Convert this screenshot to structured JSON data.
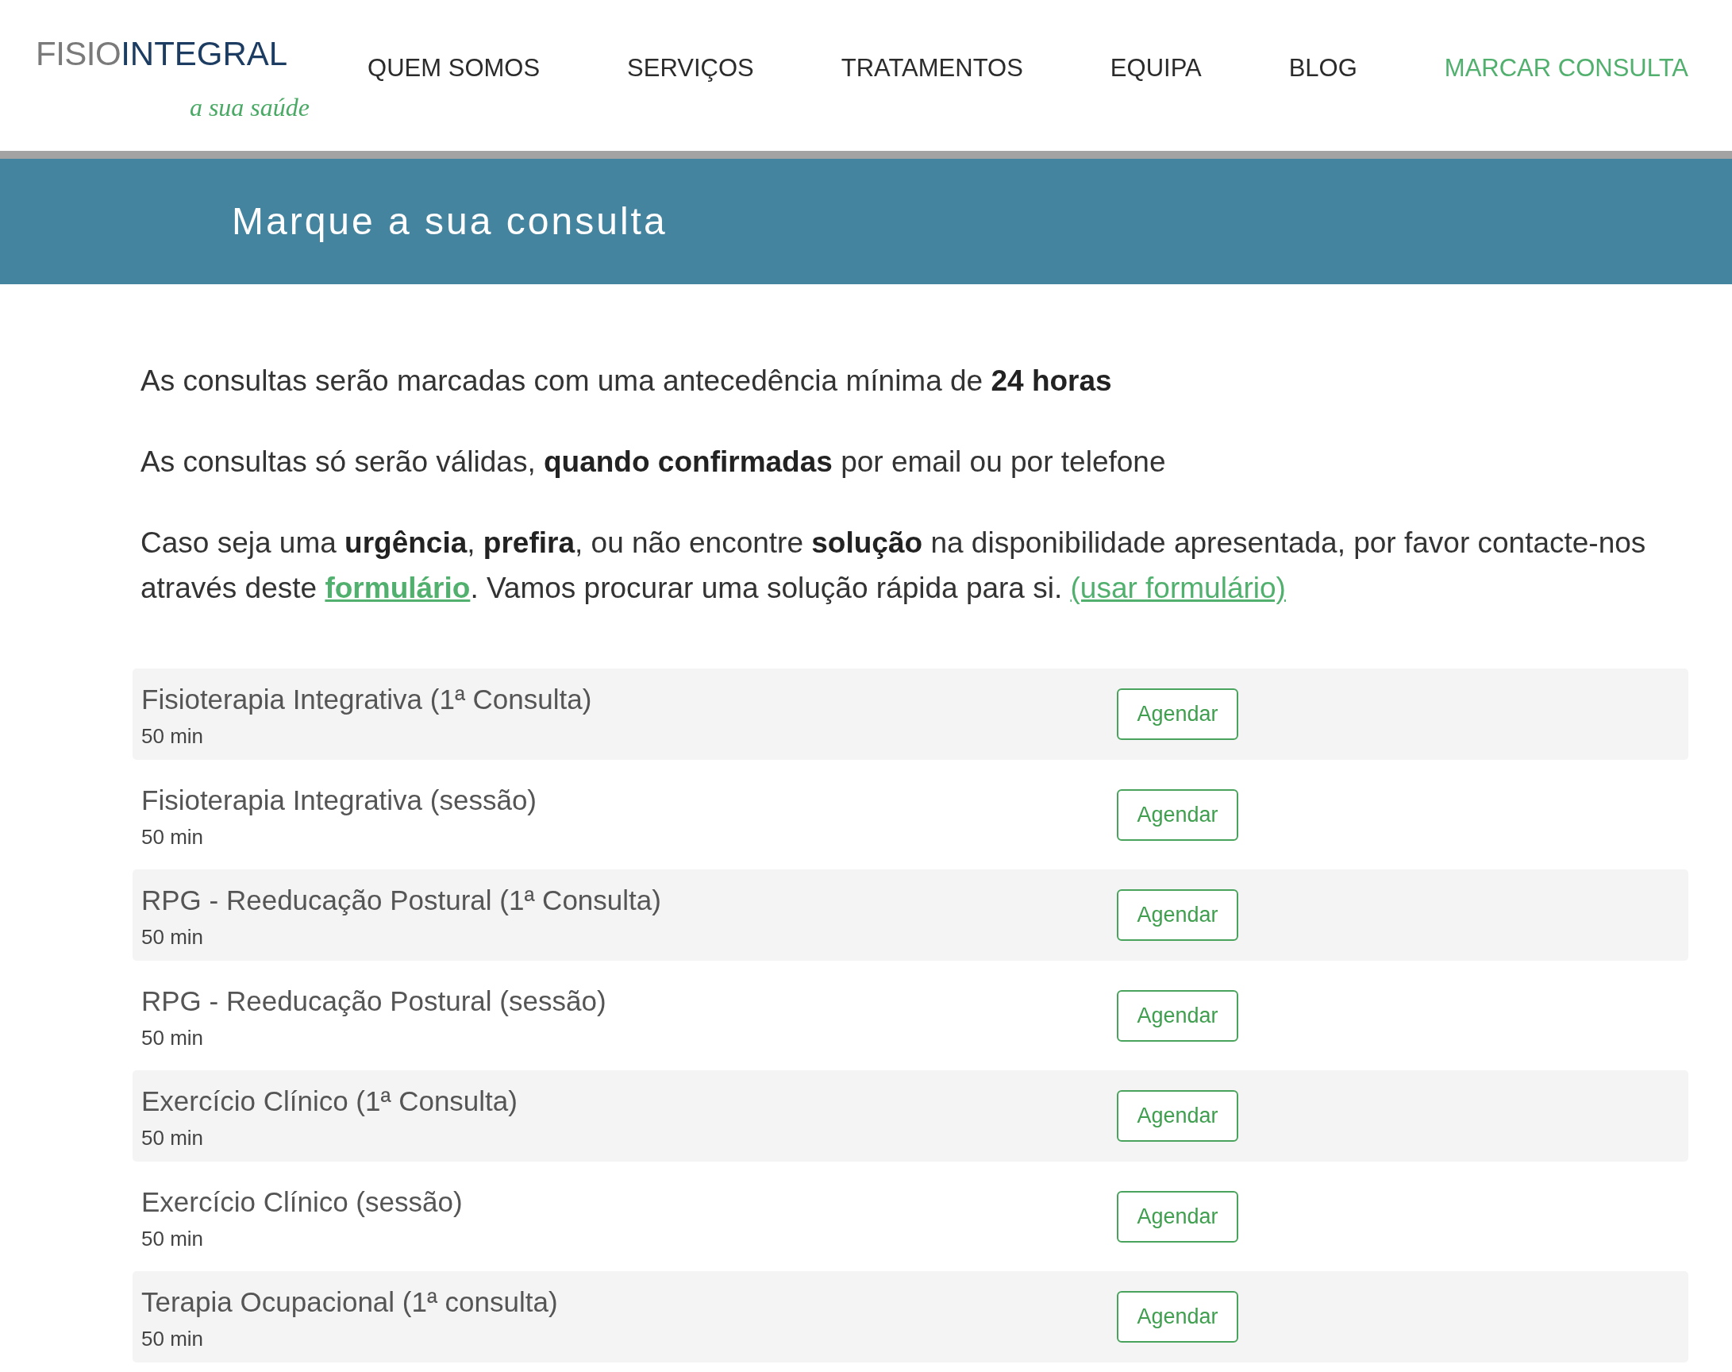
{
  "header": {
    "logo": {
      "light": "FISIO",
      "bold": "INTEGRAL",
      "tagline": "a sua saúde"
    },
    "nav": [
      {
        "label": "QUEM SOMOS",
        "selected": false
      },
      {
        "label": "SERVIÇOS",
        "selected": false
      },
      {
        "label": "TRATAMENTOS",
        "selected": false
      },
      {
        "label": "EQUIPA",
        "selected": false
      },
      {
        "label": "BLOG",
        "selected": false
      },
      {
        "label": "MARCAR CONSULTA",
        "selected": true
      }
    ]
  },
  "banner": {
    "title": "Marque a sua consulta"
  },
  "notes": [
    {
      "segments": [
        {
          "kind": "text",
          "text": "As consultas serão marcadas com uma antecedência mínima de **24 horas**"
        }
      ]
    },
    {
      "segments": [
        {
          "kind": "text",
          "text": "As consultas só serão válidas, **quando confirmadas** por email ou por telefone"
        }
      ]
    },
    {
      "segments": [
        {
          "kind": "text",
          "text": "Caso seja uma **urgência**, **prefira**, ou não encontre **solução** na disponibilidade apresentada, por favor contacte-nos através deste "
        },
        {
          "kind": "bold-link",
          "text": "formulário"
        },
        {
          "kind": "text",
          "text": ". Vamos procurar uma solução rápida para si. "
        },
        {
          "kind": "link",
          "text": "(usar formulário)"
        }
      ]
    }
  ],
  "services": [
    {
      "name": "Fisioterapia Integrativa (1ª Consulta)",
      "duration": "50 min",
      "action": "Agendar"
    },
    {
      "name": "Fisioterapia Integrativa (sessão)",
      "duration": "50 min",
      "action": "Agendar"
    },
    {
      "name": "RPG - Reeducação Postural (1ª Consulta)",
      "duration": "50 min",
      "action": "Agendar"
    },
    {
      "name": "RPG - Reeducação Postural (sessão)",
      "duration": "50 min",
      "action": "Agendar"
    },
    {
      "name": "Exercício Clínico (1ª Consulta)",
      "duration": "50 min",
      "action": "Agendar"
    },
    {
      "name": "Exercício Clínico (sessão)",
      "duration": "50 min",
      "action": "Agendar"
    },
    {
      "name": "Terapia Ocupacional (1ª consulta)",
      "duration": "50 min",
      "action": "Agendar"
    }
  ]
}
